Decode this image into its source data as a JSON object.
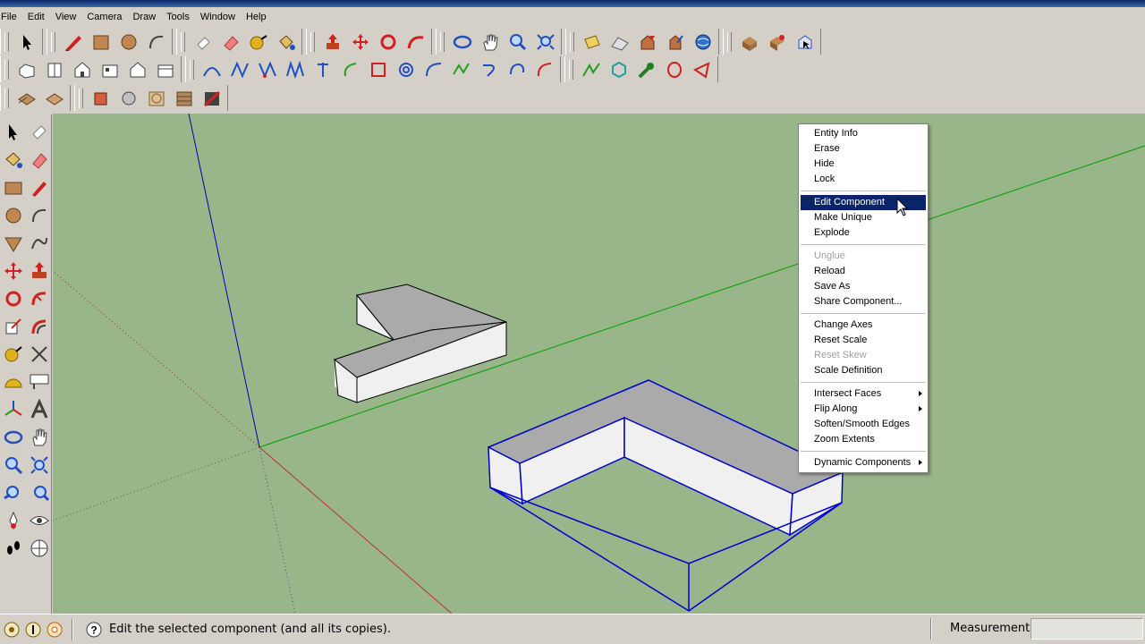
{
  "menubar": {
    "items": [
      "File",
      "Edit",
      "View",
      "Camera",
      "Draw",
      "Tools",
      "Window",
      "Help"
    ]
  },
  "context_menu": {
    "items": [
      {
        "label": "Entity Info",
        "state": "normal"
      },
      {
        "label": "Erase",
        "state": "normal"
      },
      {
        "label": "Hide",
        "state": "normal"
      },
      {
        "label": "Lock",
        "state": "normal"
      },
      {
        "label": "Edit Component",
        "state": "highlighted"
      },
      {
        "label": "Make Unique",
        "state": "normal"
      },
      {
        "label": "Explode",
        "state": "normal"
      },
      {
        "label": "Unglue",
        "state": "disabled"
      },
      {
        "label": "Reload",
        "state": "normal"
      },
      {
        "label": "Save As",
        "state": "normal"
      },
      {
        "label": "Share Component...",
        "state": "normal"
      },
      {
        "label": "Change Axes",
        "state": "normal"
      },
      {
        "label": "Reset Scale",
        "state": "normal"
      },
      {
        "label": "Reset Skew",
        "state": "disabled"
      },
      {
        "label": "Scale Definition",
        "state": "normal"
      },
      {
        "label": "Intersect Faces",
        "state": "submenu"
      },
      {
        "label": "Flip Along",
        "state": "submenu"
      },
      {
        "label": "Soften/Smooth Edges",
        "state": "normal"
      },
      {
        "label": "Zoom Extents",
        "state": "normal"
      },
      {
        "label": "Dynamic Components",
        "state": "submenu"
      }
    ]
  },
  "status": {
    "text": "Edit the selected component (and all its copies).",
    "measurements_label": "Measurements",
    "measurements_value": ""
  },
  "colors": {
    "viewport_bg": "#98b68a",
    "selection": "#0000cc",
    "menu_highlight": "#0a246a",
    "axis_red": "#c03030",
    "axis_green": "#00a000",
    "axis_blue": "#0000b0"
  }
}
